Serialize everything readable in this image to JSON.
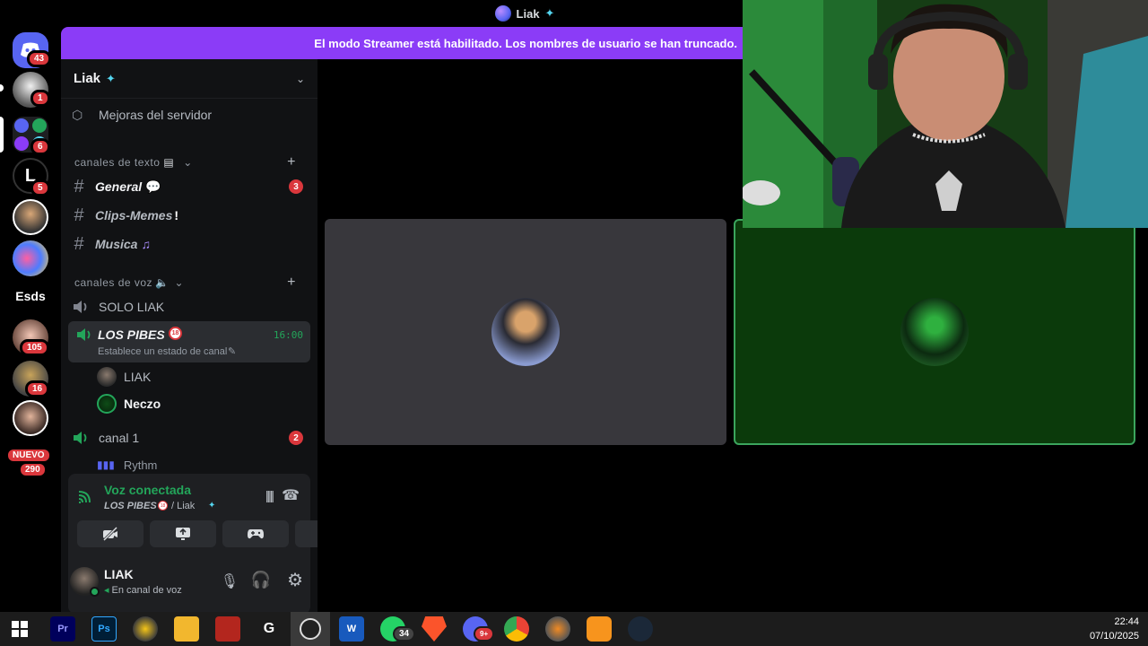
{
  "titlebar": {
    "server_name": "Liak"
  },
  "banner": {
    "text": "El modo Streamer está habilitado. Los nombres de usuario se han truncado."
  },
  "rail": {
    "badges": [
      "43",
      "1",
      "6",
      "5",
      "105",
      "16",
      "290"
    ],
    "text_server": "Esds",
    "new_label": "NUEVO"
  },
  "sidebar": {
    "server_name": "Liak",
    "boosts": "Mejoras del servidor",
    "text_category": "canales de texto",
    "voice_category": "canales de voz",
    "text_channels": [
      {
        "name": "General",
        "count": "3"
      },
      {
        "name": "Clips-Memes",
        "count": ""
      },
      {
        "name": "Musica",
        "count": ""
      }
    ],
    "voice_channels": {
      "solo": "SOLO LIAK",
      "active": {
        "name": "LOS PIBES",
        "time": "16:00",
        "status_hint": "Establece un estado de canal"
      },
      "members": [
        "LIAK",
        "Neczo"
      ],
      "canal1": {
        "name": "canal 1",
        "count": "2"
      },
      "rythm": "Rythm"
    }
  },
  "voice_panel": {
    "status": "Voz conectada",
    "channel": "LOS PIBES",
    "server": "/ Liak"
  },
  "user": {
    "name": "LIAK",
    "status": "En canal de voz"
  },
  "taskbar": {
    "whatsapp_badge": "34",
    "discord_badge": "9+",
    "time": "22:44",
    "date": "07/10/2025"
  },
  "colors": {
    "banner": "#8b3cf7",
    "connected_green": "#23a55a",
    "speaking_border": "#3ba55d",
    "badge_red": "#da373c"
  }
}
